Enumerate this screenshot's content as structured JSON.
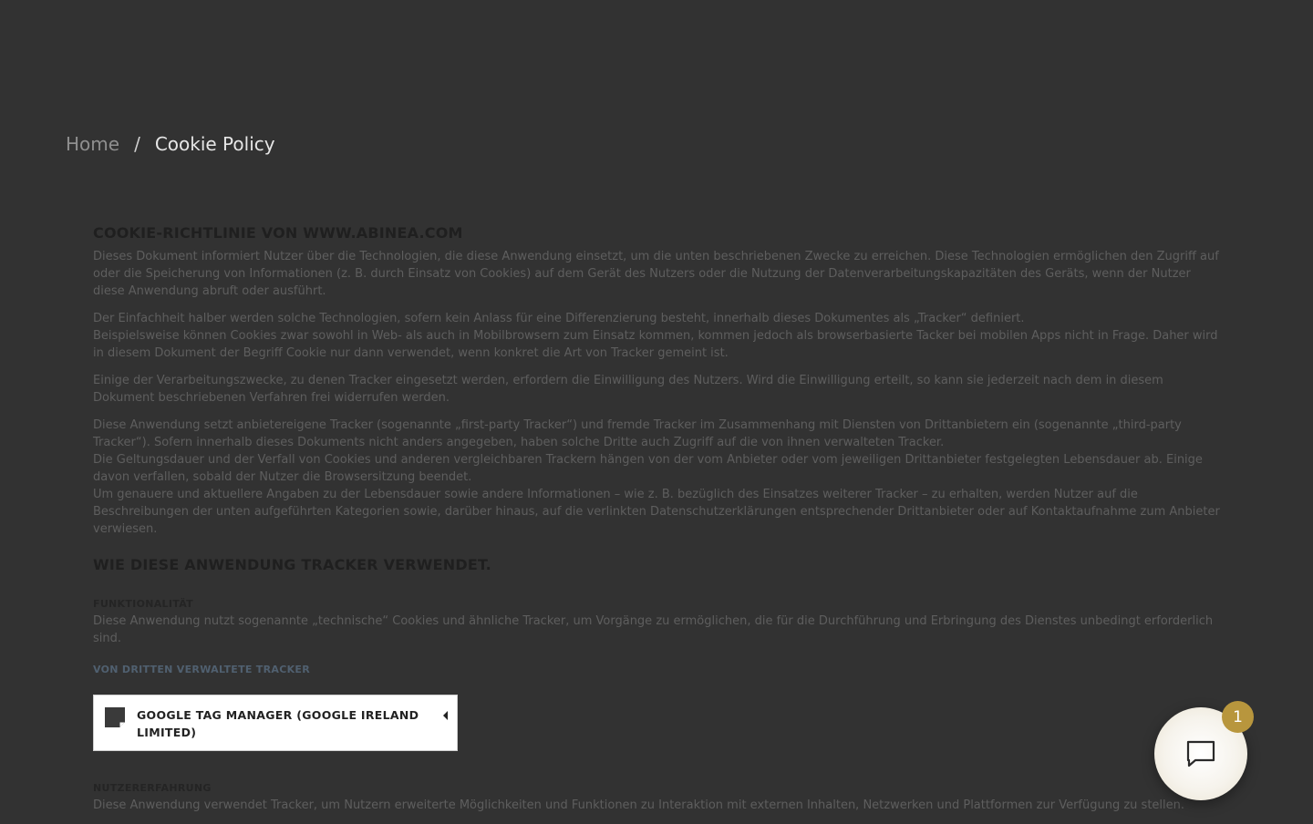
{
  "breadcrumb": {
    "home": "Home",
    "separator": "/",
    "current": "Cookie Policy"
  },
  "policy": {
    "title": "COOKIE-RICHTLINIE VON WWW.ABINEA.COM",
    "paragraphs": [
      "Dieses Dokument informiert Nutzer über die Technologien, die diese Anwendung einsetzt, um die unten beschriebenen Zwecke zu erreichen. Diese Technologien ermöglichen den Zugriff auf oder die Speicherung von Informationen (z. B. durch Einsatz von Cookies) auf dem Gerät des Nutzers oder die Nutzung der Datenverarbeitungskapazitäten des Geräts, wenn der Nutzer diese Anwendung abruft oder ausführt.",
      "Der Einfachheit halber werden solche Technologien, sofern kein Anlass für eine Differenzierung besteht, innerhalb dieses Dokumentes als „Tracker“ definiert.",
      "Beispielsweise können Cookies zwar sowohl in Web- als auch in Mobilbrowsern zum Einsatz kommen, kommen jedoch als browserbasierte Tacker bei mobilen Apps nicht in Frage. Daher wird in diesem Dokument der Begriff Cookie nur dann verwendet, wenn konkret die Art von Tracker gemeint ist.",
      "Einige der Verarbeitungszwecke, zu denen Tracker eingesetzt werden, erfordern die Einwilligung des Nutzers. Wird die Einwilligung erteilt, so kann sie jederzeit nach dem in diesem Dokument beschriebenen Verfahren frei widerrufen werden.",
      "Diese Anwendung setzt anbietereigene Tracker (sogenannte „first-party Tracker“) und fremde Tracker im Zusammenhang mit Diensten von Drittanbietern ein (sogenannte „third-party Tracker“). Sofern innerhalb dieses Dokuments nicht anders angegeben, haben solche Dritte auch Zugriff auf die von ihnen verwalteten Tracker.",
      "Die Geltungsdauer und der Verfall von Cookies und anderen vergleichbaren Trackern hängen von der vom Anbieter oder vom jeweiligen Drittanbieter festgelegten Lebensdauer ab. Einige davon verfallen, sobald der Nutzer die Browsersitzung beendet.",
      "Um genauere und aktuellere Angaben zu der Lebensdauer sowie andere Informationen – wie z. B. bezüglich des Einsatzes weiterer Tracker – zu erhalten, werden Nutzer auf die Beschreibungen der unten aufgeführten Kategorien sowie, darüber hinaus, auf die verlinkten Datenschutzerklärungen entsprechender Drittanbieter oder auf Kontaktaufnahme zum Anbieter verwiesen."
    ],
    "section_title": "WIE DIESE ANWENDUNG TRACKER VERWENDET.",
    "functionality_heading": "FUNKTIONALITÄT",
    "functionality_text": "Diese Anwendung nutzt sogenannte „technische“ Cookies und ähnliche Tracker, um Vorgänge zu ermöglichen, die für die Durchführung und Erbringung des Dienstes unbedingt erforderlich sind.",
    "third_party_heading": "VON DRITTEN VERWALTETE TRACKER",
    "tracker_name": "GOOGLE TAG MANAGER (GOOGLE IRELAND LIMITED)",
    "experience_heading": "NUTZERERFAHRUNG",
    "experience_text": "Diese Anwendung verwendet Tracker, um Nutzern erweiterte Möglichkeiten und Funktionen zu Interaktion mit externen Inhalten, Netzwerken und Plattformen zur Verfügung zu stellen."
  },
  "chat": {
    "badge_count": "1",
    "icon": "chat-bubble-icon",
    "accent": "#b8963d"
  },
  "colors": {
    "overlay": "#323232",
    "tracker_box": "#ffffff"
  }
}
